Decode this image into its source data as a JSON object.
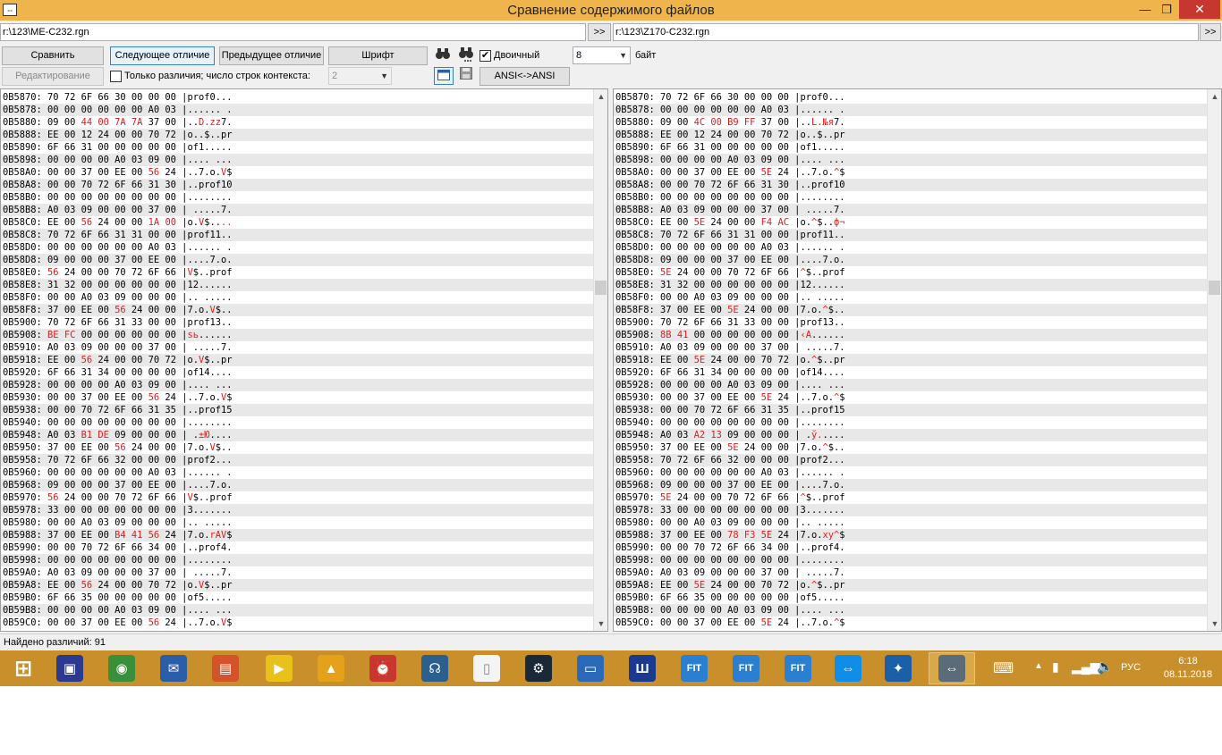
{
  "window": {
    "title": "Сравнение содержимого файлов",
    "app_icon_glyph": "⇔",
    "min_glyph": "—",
    "max_glyph": "❐",
    "close_glyph": "✕"
  },
  "paths": {
    "left": "r:\\123\\ME-C232.rgn",
    "right": "r:\\123\\Z170-C232.rgn",
    "browse_label": ">>"
  },
  "toolbar": {
    "compare": "Сравнить",
    "next_diff": "Следующее отличие",
    "prev_diff": "Предыдущее отличие",
    "font": "Шрифт",
    "binary_label": "Двоичный",
    "binary_checked": "✔",
    "bytes_value": "8",
    "bytes_label": "байт",
    "edit": "Редактирование",
    "only_diff_label": "Только различия; число строк контекста:",
    "context_value": "2",
    "ansi": "ANSI<->ANSI"
  },
  "hex_left": [
    [
      "0B5870: 70 72 6F 66 30 00 00 00 |prof0...",
      "",
      "",
      0
    ],
    [
      "0B5878: 00 00 00 00 00 00 A0 03 |...... .",
      "",
      "",
      0
    ],
    [
      "0B5880: 09 00 ",
      "44 00 7A 7A",
      " 37 00 |..",
      1,
      "D.zz",
      "7."
    ],
    [
      "0B5888: EE 00 12 24 00 00 70 72 |o..$..pr",
      "",
      "",
      0
    ],
    [
      "0B5890: 6F 66 31 00 00 00 00 00 |of1.....",
      "",
      "",
      0
    ],
    [
      "0B5898: 00 00 00 00 A0 03 09 00 |.... ...",
      "",
      "",
      0
    ],
    [
      "0B58A0: 00 00 37 00 EE 00 ",
      "56",
      " 24 |..7.o.",
      1,
      "V",
      "$"
    ],
    [
      "0B58A8: 00 00 70 72 6F 66 31 30 |..prof10",
      "",
      "",
      0
    ],
    [
      "0B58B0: 00 00 00 00 00 00 00 00 |........",
      "",
      "",
      0
    ],
    [
      "0B58B8: A0 03 09 00 00 00 37 00 | .....7.",
      "",
      "",
      0
    ],
    [
      "0B58C0: EE 00 ",
      "56",
      " 24 00 00 ",
      2,
      "1A 00",
      " |o.",
      "V$....",
      "",
      ""
    ],
    [
      "0B58C8: 70 72 6F 66 31 31 00 00 |prof11..",
      "",
      "",
      0
    ],
    [
      "0B58D0: 00 00 00 00 00 00 A0 03 |...... .",
      "",
      "",
      0
    ],
    [
      "0B58D8: 09 00 00 00 37 00 EE 00 |....7.o.",
      "",
      "",
      0
    ],
    [
      "0B58E0: ",
      "56",
      " 24 00 00 70 72 6F 66 |",
      1,
      "V",
      "$..prof"
    ],
    [
      "0B58E8: 31 32 00 00 00 00 00 00 |12......",
      "",
      "",
      0
    ],
    [
      "0B58F0: 00 00 A0 03 09 00 00 00 |.. .....",
      "",
      "",
      0
    ],
    [
      "0B58F8: 37 00 EE 00 ",
      "56",
      " 24 00 00 |7.o.",
      1,
      "V",
      "$.."
    ],
    [
      "0B5900: 70 72 6F 66 31 33 00 00 |prof13..",
      "",
      "",
      0
    ],
    [
      "0B5908: ",
      "BE FC",
      " 00 00 00 00 00 00 |",
      1,
      "sь",
      "......"
    ],
    [
      "0B5910: A0 03 09 00 00 00 37 00 | .....7.",
      "",
      "",
      0
    ],
    [
      "0B5918: EE 00 ",
      "56",
      " 24 00 00 70 72 |o.",
      1,
      "V",
      "$..pr"
    ],
    [
      "0B5920: 6F 66 31 34 00 00 00 00 |of14....",
      "",
      "",
      0
    ],
    [
      "0B5928: 00 00 00 00 A0 03 09 00 |.... ...",
      "",
      "",
      0
    ],
    [
      "0B5930: 00 00 37 00 EE 00 ",
      "56",
      " 24 |..7.o.",
      1,
      "V",
      "$"
    ],
    [
      "0B5938: 00 00 70 72 6F 66 31 35 |..prof15",
      "",
      "",
      0
    ],
    [
      "0B5940: 00 00 00 00 00 00 00 00 |........",
      "",
      "",
      0
    ],
    [
      "0B5948: A0 03 ",
      "B1 DE",
      " 09 00 00 00 | .",
      1,
      "±Ю",
      "...."
    ],
    [
      "0B5950: 37 00 EE 00 ",
      "56",
      " 24 00 00 |7.o.",
      1,
      "V",
      "$.."
    ],
    [
      "0B5958: 70 72 6F 66 32 00 00 00 |prof2...",
      "",
      "",
      0
    ],
    [
      "0B5960: 00 00 00 00 00 00 A0 03 |...... .",
      "",
      "",
      0
    ],
    [
      "0B5968: 09 00 00 00 37 00 EE 00 |....7.o.",
      "",
      "",
      0
    ],
    [
      "0B5970: ",
      "56",
      " 24 00 00 70 72 6F 66 |",
      1,
      "V",
      "$..prof"
    ],
    [
      "0B5978: 33 00 00 00 00 00 00 00 |3.......",
      "",
      "",
      0
    ],
    [
      "0B5980: 00 00 A0 03 09 00 00 00 |.. .....",
      "",
      "",
      0
    ],
    [
      "0B5988: 37 00 EE 00 ",
      "B4 41 56",
      " 24 |7.o.",
      1,
      "rAV",
      "$"
    ],
    [
      "0B5990: 00 00 70 72 6F 66 34 00 |..prof4.",
      "",
      "",
      0
    ],
    [
      "0B5998: 00 00 00 00 00 00 00 00 |........",
      "",
      "",
      0
    ],
    [
      "0B59A0: A0 03 09 00 00 00 37 00 | .....7.",
      "",
      "",
      0
    ],
    [
      "0B59A8: EE 00 ",
      "56",
      " 24 00 00 70 72 |o.",
      1,
      "V",
      "$..pr"
    ],
    [
      "0B59B0: 6F 66 35 00 00 00 00 00 |of5.....",
      "",
      "",
      0
    ],
    [
      "0B59B8: 00 00 00 00 A0 03 09 00 |.... ...",
      "",
      "",
      0
    ],
    [
      "0B59C0: 00 00 37 00 EE 00 ",
      "56",
      " 24 |..7.o.",
      1,
      "V",
      "$"
    ]
  ],
  "hex_right": [
    [
      "0B5870: 70 72 6F 66 30 00 00 00 |prof0...",
      "",
      "",
      0
    ],
    [
      "0B5878: 00 00 00 00 00 00 A0 03 |...... .",
      "",
      "",
      0
    ],
    [
      "0B5880: 09 00 ",
      "4C 00 B9 FF",
      " 37 00 |..",
      1,
      "L.№я",
      "7."
    ],
    [
      "0B5888: EE 00 12 24 00 00 70 72 |o..$..pr",
      "",
      "",
      0
    ],
    [
      "0B5890: 6F 66 31 00 00 00 00 00 |of1.....",
      "",
      "",
      0
    ],
    [
      "0B5898: 00 00 00 00 A0 03 09 00 |.... ...",
      "",
      "",
      0
    ],
    [
      "0B58A0: 00 00 37 00 EE 00 ",
      "5E",
      " 24 |..7.o.",
      1,
      "^",
      "$"
    ],
    [
      "0B58A8: 00 00 70 72 6F 66 31 30 |..prof10",
      "",
      "",
      0
    ],
    [
      "0B58B0: 00 00 00 00 00 00 00 00 |........",
      "",
      "",
      0
    ],
    [
      "0B58B8: A0 03 09 00 00 00 37 00 | .....7.",
      "",
      "",
      0
    ],
    [
      "0B58C0: EE 00 ",
      "5E",
      " 24 00 00 ",
      2,
      "F4 AC",
      " |o.",
      "^$..ф¬",
      "",
      ""
    ],
    [
      "0B58C8: 70 72 6F 66 31 31 00 00 |prof11..",
      "",
      "",
      0
    ],
    [
      "0B58D0: 00 00 00 00 00 00 A0 03 |...... .",
      "",
      "",
      0
    ],
    [
      "0B58D8: 09 00 00 00 37 00 EE 00 |....7.o.",
      "",
      "",
      0
    ],
    [
      "0B58E0: ",
      "5E",
      " 24 00 00 70 72 6F 66 |",
      1,
      "^",
      "$..prof"
    ],
    [
      "0B58E8: 31 32 00 00 00 00 00 00 |12......",
      "",
      "",
      0
    ],
    [
      "0B58F0: 00 00 A0 03 09 00 00 00 |.. .....",
      "",
      "",
      0
    ],
    [
      "0B58F8: 37 00 EE 00 ",
      "5E",
      " 24 00 00 |7.o.",
      1,
      "^",
      "$.."
    ],
    [
      "0B5900: 70 72 6F 66 31 33 00 00 |prof13..",
      "",
      "",
      0
    ],
    [
      "0B5908: ",
      "8B 41",
      " 00 00 00 00 00 00 |",
      1,
      "‹A",
      "......"
    ],
    [
      "0B5910: A0 03 09 00 00 00 37 00 | .....7.",
      "",
      "",
      0
    ],
    [
      "0B5918: EE 00 ",
      "5E",
      " 24 00 00 70 72 |o.",
      1,
      "^",
      "$..pr"
    ],
    [
      "0B5920: 6F 66 31 34 00 00 00 00 |of14....",
      "",
      "",
      0
    ],
    [
      "0B5928: 00 00 00 00 A0 03 09 00 |.... ...",
      "",
      "",
      0
    ],
    [
      "0B5930: 00 00 37 00 EE 00 ",
      "5E",
      " 24 |..7.o.",
      1,
      "^",
      "$"
    ],
    [
      "0B5938: 00 00 70 72 6F 66 31 35 |..prof15",
      "",
      "",
      0
    ],
    [
      "0B5940: 00 00 00 00 00 00 00 00 |........",
      "",
      "",
      0
    ],
    [
      "0B5948: A0 03 ",
      "A2 13",
      " 09 00 00 00 | .",
      1,
      "ў.",
      "...."
    ],
    [
      "0B5950: 37 00 EE 00 ",
      "5E",
      " 24 00 00 |7.o.",
      1,
      "^",
      "$.."
    ],
    [
      "0B5958: 70 72 6F 66 32 00 00 00 |prof2...",
      "",
      "",
      0
    ],
    [
      "0B5960: 00 00 00 00 00 00 A0 03 |...... .",
      "",
      "",
      0
    ],
    [
      "0B5968: 09 00 00 00 37 00 EE 00 |....7.o.",
      "",
      "",
      0
    ],
    [
      "0B5970: ",
      "5E",
      " 24 00 00 70 72 6F 66 |",
      1,
      "^",
      "$..prof"
    ],
    [
      "0B5978: 33 00 00 00 00 00 00 00 |3.......",
      "",
      "",
      0
    ],
    [
      "0B5980: 00 00 A0 03 09 00 00 00 |.. .....",
      "",
      "",
      0
    ],
    [
      "0B5988: 37 00 EE 00 ",
      "78 F3 5E",
      " 24 |7.o.",
      1,
      "xу^",
      "$"
    ],
    [
      "0B5990: 00 00 70 72 6F 66 34 00 |..prof4.",
      "",
      "",
      0
    ],
    [
      "0B5998: 00 00 00 00 00 00 00 00 |........",
      "",
      "",
      0
    ],
    [
      "0B59A0: A0 03 09 00 00 00 37 00 | .....7.",
      "",
      "",
      0
    ],
    [
      "0B59A8: EE 00 ",
      "5E",
      " 24 00 00 70 72 |o.",
      1,
      "^",
      "$..pr"
    ],
    [
      "0B59B0: 6F 66 35 00 00 00 00 00 |of5.....",
      "",
      "",
      0
    ],
    [
      "0B59B8: 00 00 00 00 A0 03 09 00 |.... ...",
      "",
      "",
      0
    ],
    [
      "0B59C0: 00 00 37 00 EE 00 ",
      "5E",
      " 24 |..7.o.",
      1,
      "^",
      "$"
    ]
  ],
  "status": {
    "diff_count": "Найдено различий: 91"
  },
  "taskbar": {
    "items": [
      {
        "name": "start-icon",
        "glyph": "⊞",
        "color": "#c98f2a"
      },
      {
        "name": "save-app-icon",
        "glyph": "▣",
        "color": "#2b3a8f"
      },
      {
        "name": "chrome-icon",
        "glyph": "◉",
        "color": "#3a8f3a"
      },
      {
        "name": "thunderbird-icon",
        "glyph": "✉",
        "color": "#2a5ea8"
      },
      {
        "name": "screen-capture-icon",
        "glyph": "▤",
        "color": "#d3542a"
      },
      {
        "name": "player-icon",
        "glyph": "▶",
        "color": "#e8c21a"
      },
      {
        "name": "aimp-icon",
        "glyph": "▲",
        "color": "#e6a11a"
      },
      {
        "name": "alarm-icon",
        "glyph": "⏰",
        "color": "#c7372f"
      },
      {
        "name": "headset-icon",
        "glyph": "☊",
        "color": "#2a5f8f"
      },
      {
        "name": "document-icon",
        "glyph": "▯",
        "color": "#f4f4f4"
      },
      {
        "name": "steam-icon",
        "glyph": "⚙",
        "color": "#1b2838"
      },
      {
        "name": "remote-desktop-icon",
        "glyph": "▭",
        "color": "#2a6ab8"
      },
      {
        "name": "meter-icon",
        "glyph": "Ш",
        "color": "#1a3a8f"
      },
      {
        "name": "fit-icon-1",
        "glyph": "FIT",
        "color": "#2a7fd0"
      },
      {
        "name": "fit-icon-2",
        "glyph": "FIT",
        "color": "#2a7fd0"
      },
      {
        "name": "fit-icon-3",
        "glyph": "FIT",
        "color": "#2a7fd0"
      },
      {
        "name": "teamviewer-icon",
        "glyph": "⇔",
        "color": "#0e8ee9"
      },
      {
        "name": "virtualbox-icon",
        "glyph": "✦",
        "color": "#1a5fa8"
      },
      {
        "name": "file-compare-icon",
        "glyph": "⇔",
        "color": "#5a6b7a"
      }
    ],
    "tray_lang": "РУС",
    "time": "6:18",
    "date": "08.11.2018",
    "accent": "#c98f2a"
  }
}
